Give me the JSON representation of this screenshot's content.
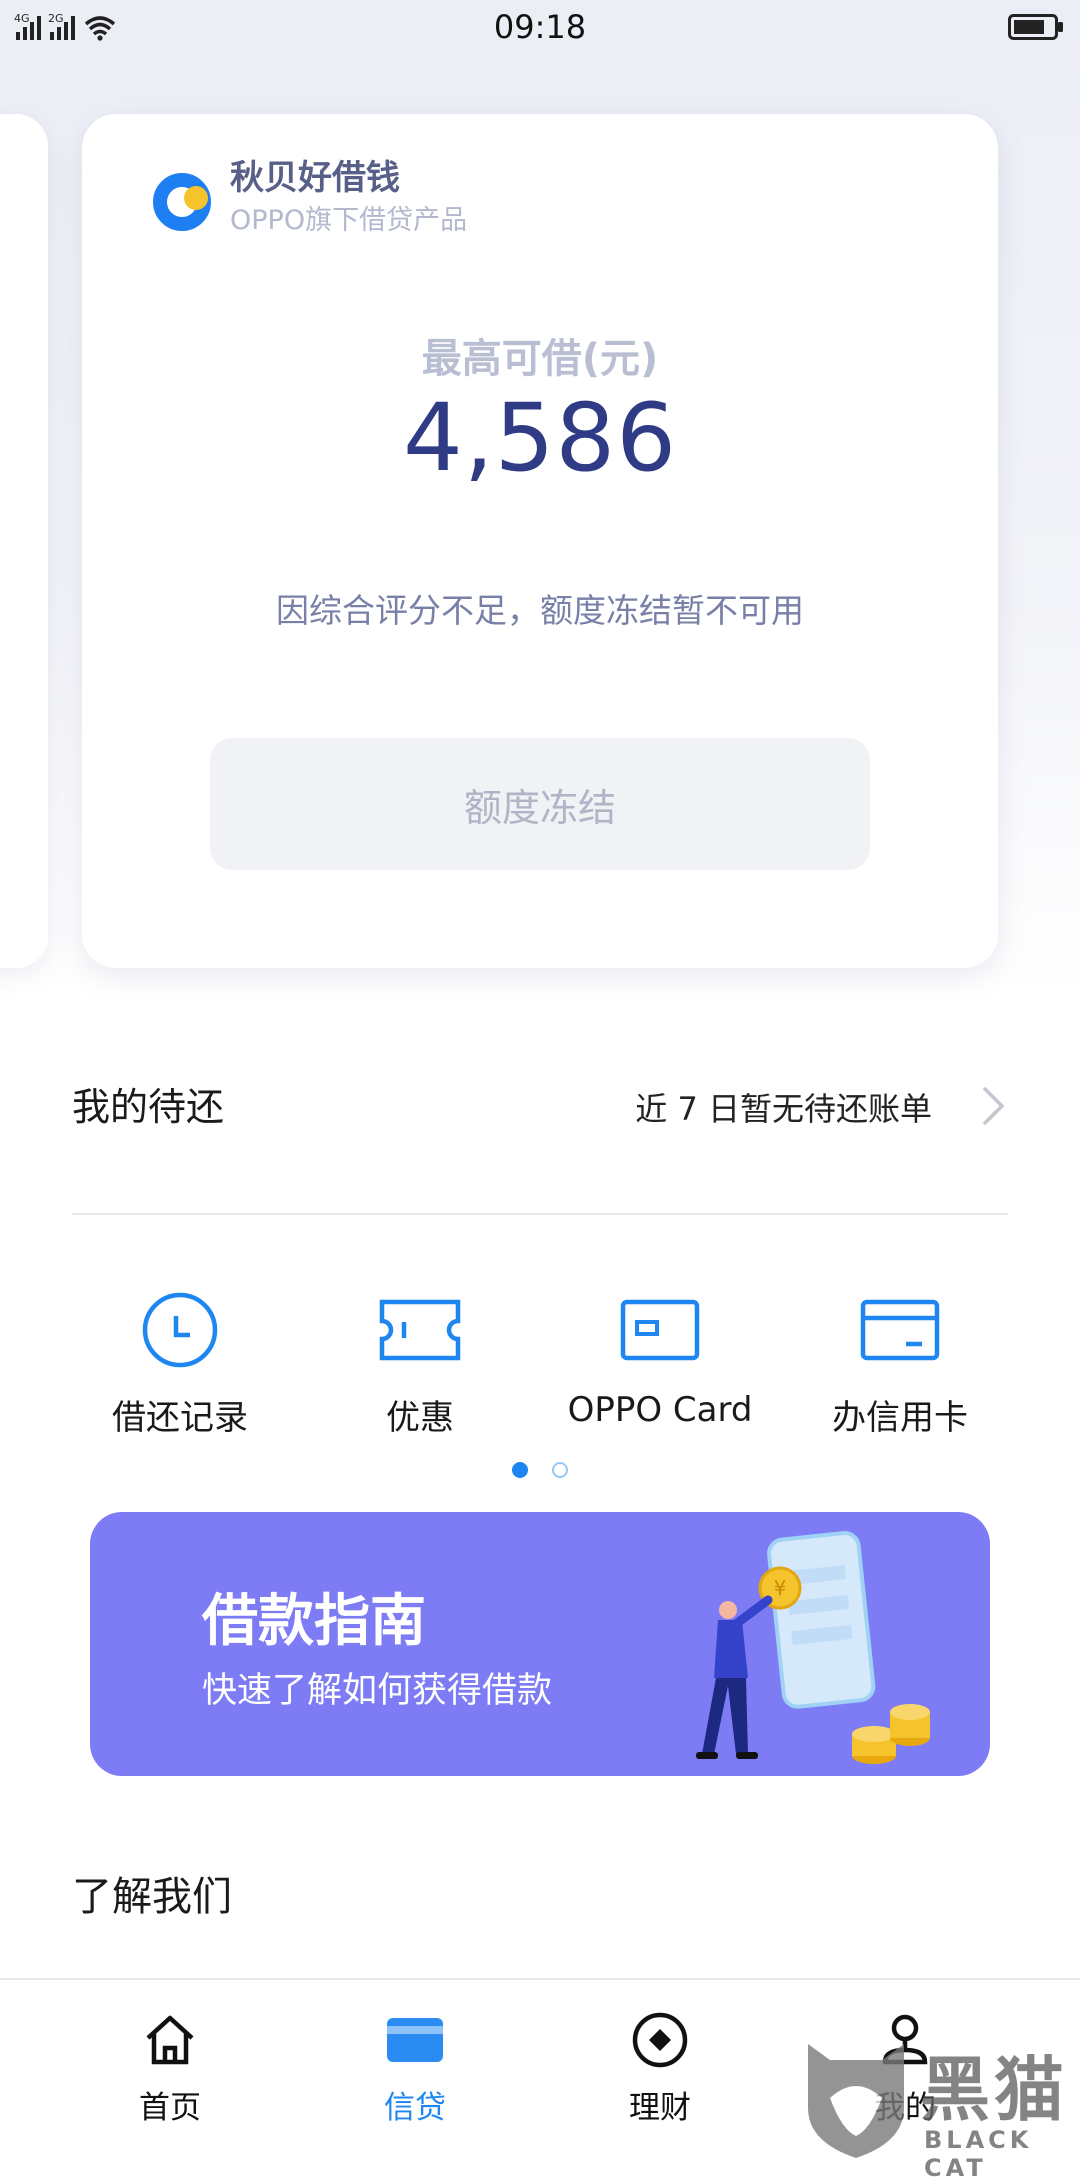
{
  "status_bar": {
    "network1": "4G",
    "network2": "2G",
    "time": "09:18"
  },
  "loan_card": {
    "brand_name": "秋贝好借钱",
    "brand_subtitle": "OPPO旗下借贷产品",
    "limit_label": "最高可借(元)",
    "limit_amount": "4,586",
    "frozen_note": "因综合评分不足，额度冻结暂不可用",
    "button_label": "额度冻结"
  },
  "pending": {
    "title": "我的待还",
    "status": "近 7 日暂无待还账单"
  },
  "quick_entries": [
    {
      "label": "借还记录",
      "icon": "clock-icon"
    },
    {
      "label": "优惠",
      "icon": "coupon-icon"
    },
    {
      "label": "OPPO Card",
      "icon": "card-icon"
    },
    {
      "label": "办信用卡",
      "icon": "credit-card-icon"
    }
  ],
  "pager": {
    "pages": 2,
    "current": 1
  },
  "banner": {
    "title": "借款指南",
    "subtitle": "快速了解如何获得借款",
    "coin_symbol": "¥"
  },
  "about": {
    "title": "了解我们"
  },
  "bottom_nav": [
    {
      "label": "首页",
      "icon": "home-icon",
      "active": false
    },
    {
      "label": "信贷",
      "icon": "credit-icon",
      "active": true
    },
    {
      "label": "理财",
      "icon": "finance-icon",
      "active": false
    },
    {
      "label": "我的",
      "icon": "profile-icon",
      "active": false
    }
  ],
  "watermark": {
    "big": "黑猫",
    "small": "BLACK CAT"
  },
  "colors": {
    "accent_blue": "#1e86f0",
    "amount_navy": "#2f3b84",
    "banner_purple": "#7d7cf5",
    "logo_yellow": "#f5c42c"
  }
}
